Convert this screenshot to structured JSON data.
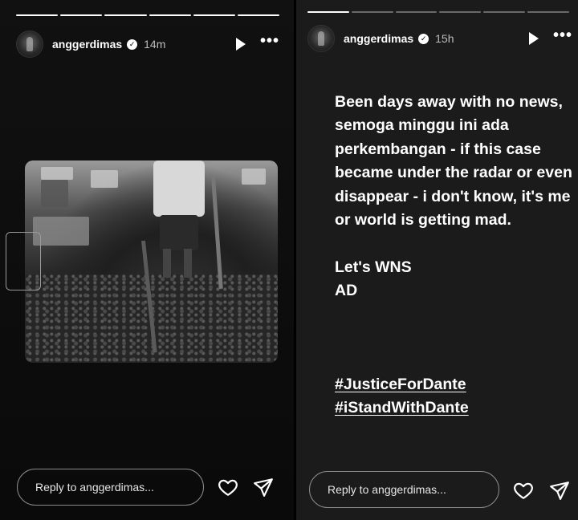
{
  "left_story": {
    "username": "anggerdimas",
    "time": "14m",
    "progress_done": 6,
    "progress_total": 6,
    "reply_placeholder": "Reply to anggerdimas..."
  },
  "right_story": {
    "username": "anggerdimas",
    "time": "15h",
    "progress_done": 1,
    "progress_total": 6,
    "text": "Been days away with no news, semoga minggu ini ada perkembangan - if this case became under the radar or even disappear - i don't know, it's me or world is getting mad.\n\nLet's WNS\nAD",
    "hashtags": [
      "#JusticeForDante",
      "#iStandWithDante"
    ],
    "reply_placeholder": "Reply to anggerdimas..."
  },
  "icons": {
    "verified": "verified-badge-icon",
    "play": "play-icon",
    "more": "more-icon",
    "heart": "heart-icon",
    "send": "send-icon"
  }
}
